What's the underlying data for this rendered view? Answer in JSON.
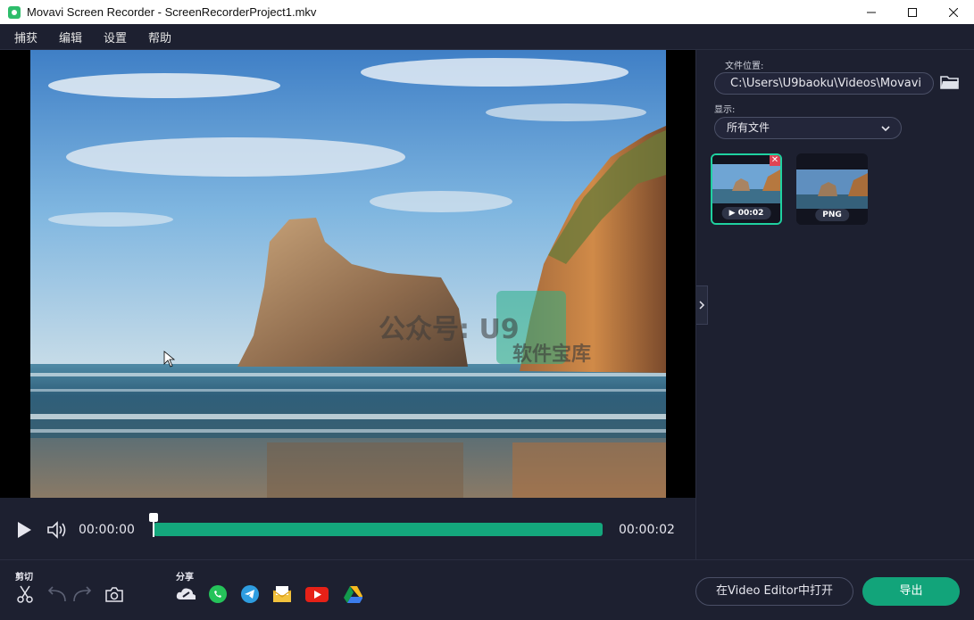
{
  "window": {
    "title": "Movavi Screen Recorder - ScreenRecorderProject1.mkv"
  },
  "menu": [
    {
      "label": "捕获"
    },
    {
      "label": "编辑"
    },
    {
      "label": "设置"
    },
    {
      "label": "帮助"
    }
  ],
  "player": {
    "current_time": "00:00:00",
    "total_time": "00:00:02",
    "progress_fraction": 0.0,
    "watermark_main": "公众号: U9",
    "watermark_sub": "软件宝库"
  },
  "right_panel": {
    "file_location_label": "文件位置:",
    "file_location_value": "C:\\Users\\U9baoku\\Videos\\Movavi",
    "show_label": "显示:",
    "show_value": "所有文件",
    "thumbnails": [
      {
        "badge": "00:02",
        "type": "video",
        "selected": true
      },
      {
        "badge": "PNG",
        "type": "image",
        "selected": false
      }
    ]
  },
  "bottom": {
    "cut_label": "剪切",
    "share_label": "分享",
    "open_editor_label": "在Video Editor中打开",
    "export_label": "导出"
  },
  "colors": {
    "accent": "#12a47a",
    "background": "#1d2030",
    "selection": "#1fd1a0"
  }
}
